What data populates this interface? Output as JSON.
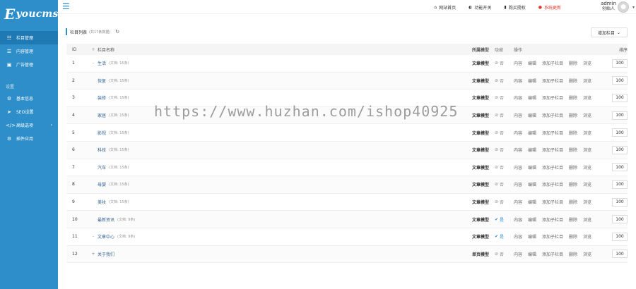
{
  "sidebar": {
    "logo_e": "E",
    "logo_rest": "youcms",
    "items": [
      {
        "label": "栏目管理",
        "icon": "sitemap-icon"
      },
      {
        "label": "内容管理",
        "icon": "list-icon"
      },
      {
        "label": "广告管理",
        "icon": "image-icon"
      }
    ],
    "group_label": "设置",
    "group_items": [
      {
        "label": "基本信息",
        "icon": "gear-icon"
      },
      {
        "label": "SEO设置",
        "icon": "paper-plane-icon"
      },
      {
        "label": "高级选项",
        "icon": "code-icon"
      },
      {
        "label": "插件应用",
        "icon": "cog-icon"
      }
    ]
  },
  "topbar": {
    "links": [
      {
        "label": "网站首页",
        "icon": "home-icon"
      },
      {
        "label": "功能开关",
        "icon": "toggle-icon"
      },
      {
        "label": "购买授权",
        "icon": "bookmark-icon"
      },
      {
        "label": "系统更新",
        "icon": "alert-icon"
      }
    ],
    "user_name": "admin",
    "user_role": "创始人"
  },
  "list": {
    "title": "栏目列表",
    "subtitle": "(共17条数据)",
    "add_button": "增加栏目"
  },
  "table": {
    "headers": {
      "id": "ID",
      "name": "栏目名称",
      "model": "所属模型",
      "hide": "隐藏",
      "ops": "操作",
      "sort": "排序"
    },
    "rows": [
      {
        "id": "1",
        "pre": "-",
        "name": "生活",
        "count": "(文档: 15条)",
        "model": "文章模型",
        "hide": "否",
        "hidden": false,
        "sort": "100"
      },
      {
        "id": "2",
        "pre": "",
        "name": "恢复",
        "count": "(文档: 15条)",
        "model": "文章模型",
        "hide": "否",
        "hidden": false,
        "sort": "100"
      },
      {
        "id": "3",
        "pre": "",
        "name": "装修",
        "count": "(文档: 15条)",
        "model": "文章模型",
        "hide": "否",
        "hidden": false,
        "sort": "100"
      },
      {
        "id": "4",
        "pre": "",
        "name": "家居",
        "count": "(文档: 15条)",
        "model": "文章模型",
        "hide": "否",
        "hidden": false,
        "sort": "100"
      },
      {
        "id": "5",
        "pre": "",
        "name": "影视",
        "count": "(文档: 15条)",
        "model": "文章模型",
        "hide": "否",
        "hidden": false,
        "sort": "100"
      },
      {
        "id": "6",
        "pre": "",
        "name": "科技",
        "count": "(文档: 15条)",
        "model": "文章模型",
        "hide": "否",
        "hidden": false,
        "sort": "100"
      },
      {
        "id": "7",
        "pre": "",
        "name": "汽车",
        "count": "(文档: 15条)",
        "model": "文章模型",
        "hide": "否",
        "hidden": false,
        "sort": "100"
      },
      {
        "id": "8",
        "pre": "",
        "name": "母婴",
        "count": "(文档: 15条)",
        "model": "文章模型",
        "hide": "否",
        "hidden": false,
        "sort": "100"
      },
      {
        "id": "9",
        "pre": "",
        "name": "美妆",
        "count": "(文档: 15条)",
        "model": "文章模型",
        "hide": "否",
        "hidden": false,
        "sort": "100"
      },
      {
        "id": "10",
        "pre": "",
        "name": "最新资讯",
        "count": "(文档: 9条)",
        "model": "文章模型",
        "hide": "是",
        "hidden": true,
        "sort": "100"
      },
      {
        "id": "11",
        "pre": "-",
        "name": "文章中心",
        "count": "(文档: 9条)",
        "model": "文章模型",
        "hide": "是",
        "hidden": true,
        "sort": "100"
      },
      {
        "id": "12",
        "pre": "+",
        "name": "关于我们",
        "count": "",
        "model": "单页模型",
        "hide": "否",
        "hidden": false,
        "sort": "100"
      }
    ],
    "ops": [
      "内容",
      "编辑",
      "添加子栏目",
      "删除",
      "浏览"
    ]
  },
  "watermark": "https://www.huzhan.com/ishop40925"
}
